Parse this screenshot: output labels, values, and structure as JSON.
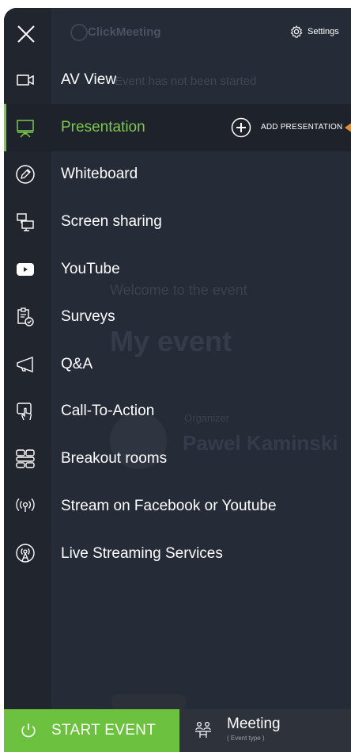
{
  "background": {
    "logo": "ClickMeeting",
    "status": "Event has not been started",
    "welcome": "Welcome to the event",
    "event_title": "My event",
    "organizer_label": "Organizer",
    "organizer_name": "Pawel Kaminski"
  },
  "header": {
    "settings_label": "Settings"
  },
  "menu": {
    "items": [
      {
        "label": "AV View",
        "icon": "camera-icon"
      },
      {
        "label": "Presentation",
        "icon": "presentation-icon",
        "active": true
      },
      {
        "label": "Whiteboard",
        "icon": "pencil-icon"
      },
      {
        "label": "Screen sharing",
        "icon": "screen-share-icon"
      },
      {
        "label": "YouTube",
        "icon": "youtube-icon"
      },
      {
        "label": "Surveys",
        "icon": "survey-icon"
      },
      {
        "label": "Q&A",
        "icon": "megaphone-icon"
      },
      {
        "label": "Call-To-Action",
        "icon": "touch-icon"
      },
      {
        "label": "Breakout rooms",
        "icon": "breakout-icon"
      },
      {
        "label": "Stream on Facebook or Youtube",
        "icon": "stream-icon"
      },
      {
        "label": "Live Streaming Services",
        "icon": "broadcast-icon"
      }
    ],
    "add_presentation_label": "ADD PRESENTATION"
  },
  "footer": {
    "start_label": "START EVENT",
    "event_type_name": "Meeting",
    "event_type_caption": "( Event type )"
  },
  "colors": {
    "accent": "#6cc13f",
    "active_text": "#7bc84f",
    "panel": "#262c37",
    "pointer": "#f08a24"
  }
}
